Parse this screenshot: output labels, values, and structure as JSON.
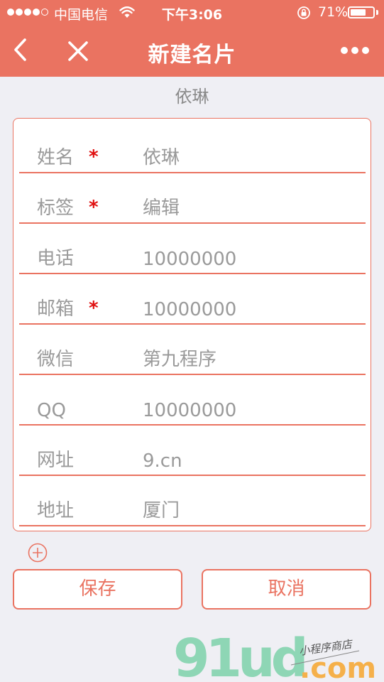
{
  "status_bar": {
    "carrier": "中国电信",
    "time": "下午3:06",
    "battery_percent": "71%",
    "battery_level": 0.71,
    "signal_bars_filled": 4,
    "signal_bars_total": 5
  },
  "nav": {
    "title": "新建名片",
    "back_icon": "chevron-left-icon",
    "close_icon": "close-icon",
    "more_icon": "more-dots-icon"
  },
  "subtitle": "依琳",
  "form": {
    "fields": [
      {
        "label": "姓名",
        "required": true,
        "value": "依琳"
      },
      {
        "label": "标签",
        "required": true,
        "value": "编辑"
      },
      {
        "label": "电话",
        "required": false,
        "value": "10000000"
      },
      {
        "label": "邮箱",
        "required": true,
        "value": "10000000"
      },
      {
        "label": "微信",
        "required": false,
        "value": "第九程序"
      },
      {
        "label": "QQ",
        "required": false,
        "value": "10000000"
      },
      {
        "label": "网址",
        "required": false,
        "value": "9.cn"
      },
      {
        "label": "地址",
        "required": false,
        "value": "厦门"
      }
    ],
    "required_mark": "*"
  },
  "actions": {
    "add_icon": "plus-circle-icon",
    "save_label": "保存",
    "cancel_label": "取消"
  },
  "watermark": {
    "logo_text": "91ud",
    "domain_text": ".com",
    "tagline": "小程序商店"
  },
  "colors": {
    "accent": "#ea7361",
    "background": "#efeff4",
    "required": "#e01010",
    "text_muted": "#9a9a9a",
    "logo_green": "#8ed6b5",
    "logo_orange": "#f5b04a"
  }
}
